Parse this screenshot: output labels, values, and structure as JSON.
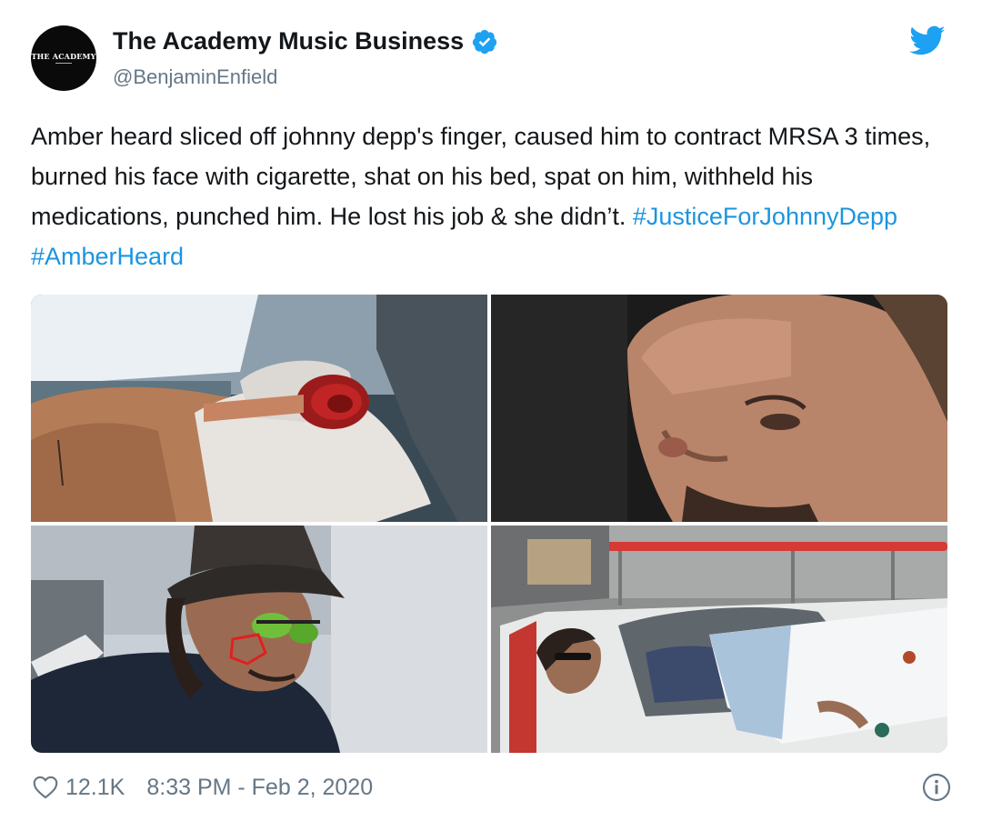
{
  "tweet": {
    "avatar_text": "THE ACADEMY",
    "display_name": "The Academy Music Business",
    "handle": "@BenjaminEnfield",
    "text_plain": "Amber heard sliced off johnny depp's finger, caused him to contract MRSA 3 times, burned his face with cigarette, shat on his bed, spat on him, withheld his medications, punched him. He lost his job & she didn’t.",
    "hashtags": [
      "#JusticeForJohnnyDepp",
      "#AmberHeard"
    ],
    "likes": "12.1K",
    "timestamp": "8:33 PM - Feb 2, 2020"
  },
  "icons": {
    "verified": "verified-badge-icon",
    "brand": "twitter-bird-icon",
    "like": "heart-icon",
    "info": "info-icon"
  },
  "colors": {
    "link": "#1b95e0",
    "verified": "#1da1f2",
    "secondary_text": "#657786",
    "primary_text": "#14171a"
  },
  "media": [
    {
      "name": "photo-injured-finger"
    },
    {
      "name": "photo-face-closeup"
    },
    {
      "name": "photo-man-in-hat"
    },
    {
      "name": "photo-man-on-stretcher"
    }
  ]
}
